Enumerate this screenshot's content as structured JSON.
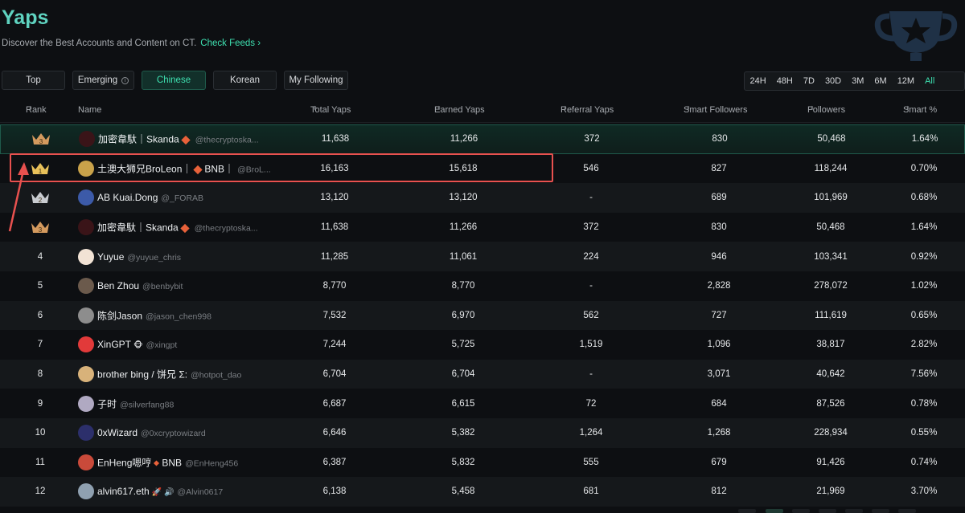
{
  "header": {
    "title": "Yaps",
    "subtitle": "Discover the Best Accounts and Content on CT.",
    "check_feeds": "Check Feeds",
    "check_feeds_chevron": "›"
  },
  "filters": [
    {
      "label": "Top",
      "active": false
    },
    {
      "label": "Emerging",
      "active": false,
      "info": true
    },
    {
      "label": "Chinese",
      "active": true
    },
    {
      "label": "Korean",
      "active": false
    },
    {
      "label": "My Following",
      "active": false
    }
  ],
  "periods": [
    {
      "label": "24H",
      "active": false
    },
    {
      "label": "48H",
      "active": false
    },
    {
      "label": "7D",
      "active": false
    },
    {
      "label": "30D",
      "active": false
    },
    {
      "label": "3M",
      "active": false
    },
    {
      "label": "6M",
      "active": false
    },
    {
      "label": "12M",
      "active": false
    },
    {
      "label": "All",
      "active": true
    }
  ],
  "columns": {
    "rank": "Rank",
    "name": "Name",
    "total": "Total Yaps",
    "earned": "Earned Yaps",
    "referral": "Referral Yaps",
    "smart": "Smart Followers",
    "followers": "Followers",
    "smart_pct": "Smart %"
  },
  "sort_glyph": "⬍",
  "colors": {
    "accent": "#3ee0b0",
    "gold": "#e8c15a",
    "silver": "#c9ccd1",
    "bronze": "#d49a5e",
    "annotation_red": "#e8514f",
    "diamond": "#e8613a"
  },
  "rows": [
    {
      "rank": "3",
      "medal": "bronze",
      "name": "加密韋馱｜Skanda",
      "diamond_after": true,
      "suffix": "",
      "handle": "@thecryptoska...",
      "total": "11,638",
      "earned": "11,266",
      "referral": "372",
      "smart": "830",
      "followers": "50,468",
      "pct": "1.64%",
      "highlight": true,
      "avatar": "#3a1418"
    },
    {
      "rank": "1",
      "medal": "gold",
      "name": "土澳大狮兄BroLeon｜",
      "diamond_after": true,
      "suffix": "BNB｜",
      "handle": "@BroL...",
      "total": "16,163",
      "earned": "15,618",
      "referral": "546",
      "smart": "827",
      "followers": "118,244",
      "pct": "0.70%",
      "avatar": "#c9a24a"
    },
    {
      "rank": "2",
      "medal": "silver",
      "name": "AB Kuai.Dong",
      "diamond_after": false,
      "suffix": "",
      "handle": "@_FORAB",
      "total": "13,120",
      "earned": "13,120",
      "referral": "-",
      "smart": "689",
      "followers": "101,969",
      "pct": "0.68%",
      "avatar": "#3c5aa8"
    },
    {
      "rank": "3",
      "medal": "bronze",
      "name": "加密韋馱｜Skanda",
      "diamond_after": true,
      "suffix": "",
      "handle": "@thecryptoska...",
      "total": "11,638",
      "earned": "11,266",
      "referral": "372",
      "smart": "830",
      "followers": "50,468",
      "pct": "1.64%",
      "avatar": "#3a1418"
    },
    {
      "rank": "4",
      "name": "Yuyue",
      "diamond_after": false,
      "suffix": "",
      "handle": "@yuyue_chris",
      "total": "11,285",
      "earned": "11,061",
      "referral": "224",
      "smart": "946",
      "followers": "103,341",
      "pct": "0.92%",
      "avatar": "#f2e3d5"
    },
    {
      "rank": "5",
      "name": "Ben Zhou",
      "diamond_after": false,
      "suffix": "",
      "handle": "@benbybit",
      "total": "8,770",
      "earned": "8,770",
      "referral": "-",
      "smart": "2,828",
      "followers": "278,072",
      "pct": "1.02%",
      "avatar": "#6b5a4c"
    },
    {
      "rank": "6",
      "name": "陈剑Jason",
      "diamond_after": false,
      "suffix": "",
      "handle": "@jason_chen998",
      "total": "7,532",
      "earned": "6,970",
      "referral": "562",
      "smart": "727",
      "followers": "111,619",
      "pct": "0.65%",
      "avatar": "#8d8d8d"
    },
    {
      "rank": "7",
      "name": "XinGPT",
      "emoji": "🐵",
      "diamond_after": false,
      "suffix": "",
      "handle": "@xingpt",
      "total": "7,244",
      "earned": "5,725",
      "referral": "1,519",
      "smart": "1,096",
      "followers": "38,817",
      "pct": "2.82%",
      "avatar": "#e23a3a"
    },
    {
      "rank": "8",
      "name": "brother bing / 饼兄 Σ:",
      "diamond_after": false,
      "suffix": "",
      "handle": "@hotpot_dao",
      "total": "6,704",
      "earned": "6,704",
      "referral": "-",
      "smart": "3,071",
      "followers": "40,642",
      "pct": "7.56%",
      "avatar": "#d8b27a"
    },
    {
      "rank": "9",
      "name": "子时",
      "diamond_after": false,
      "suffix": "",
      "handle": "@silverfang88",
      "total": "6,687",
      "earned": "6,615",
      "referral": "72",
      "smart": "684",
      "followers": "87,526",
      "pct": "0.78%",
      "avatar": "#b0a9c2"
    },
    {
      "rank": "10",
      "name": "0xWizard",
      "diamond_after": false,
      "suffix": "",
      "handle": "@0xcryptowizard",
      "total": "6,646",
      "earned": "5,382",
      "referral": "1,264",
      "smart": "1,268",
      "followers": "228,934",
      "pct": "0.55%",
      "avatar": "#2c2f6b"
    },
    {
      "rank": "11",
      "name": "EnHeng嗯哼",
      "diamond_small": true,
      "diamond_after": false,
      "suffix": "BNB",
      "handle": "@EnHeng456",
      "total": "6,387",
      "earned": "5,832",
      "referral": "555",
      "smart": "679",
      "followers": "91,426",
      "pct": "0.74%",
      "avatar": "#c94a3a"
    },
    {
      "rank": "12",
      "name": "alvin617.eth",
      "emoji": "🚀 🔊",
      "diamond_after": false,
      "suffix": "",
      "handle": "@Alvin0617",
      "total": "6,138",
      "earned": "5,458",
      "referral": "681",
      "smart": "812",
      "followers": "21,969",
      "pct": "3.70%",
      "avatar": "#8fa0b0"
    }
  ]
}
